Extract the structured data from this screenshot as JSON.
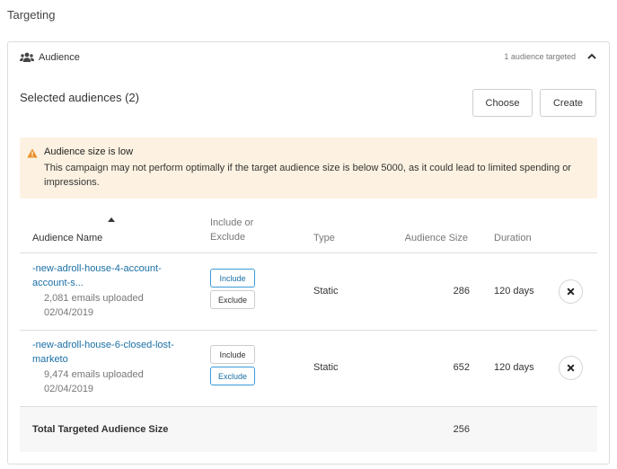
{
  "section_title": "Targeting",
  "panel": {
    "label": "Audience",
    "targeted_count": "1 audience targeted"
  },
  "selected_title": "Selected audiences (2)",
  "buttons": {
    "choose": "Choose",
    "create": "Create"
  },
  "warning": {
    "title": "Audience size is low",
    "text": "This campaign may not perform optimally if the target audience size is below 5000, as it could lead to limited spending or impressions."
  },
  "table": {
    "headers": {
      "name": "Audience Name",
      "include_exclude": "Include or Exclude",
      "type": "Type",
      "size": "Audience Size",
      "duration": "Duration"
    },
    "rows": [
      {
        "name": "-new-adroll-house-4-account-account-s...",
        "uploaded": "2,081 emails uploaded",
        "date": "02/04/2019",
        "include_label": "Include",
        "exclude_label": "Exclude",
        "selected": "include",
        "type": "Static",
        "size": "286",
        "duration": "120 days"
      },
      {
        "name": "-new-adroll-house-6-closed-lost-marketo",
        "uploaded": "9,474 emails uploaded",
        "date": "02/04/2019",
        "include_label": "Include",
        "exclude_label": "Exclude",
        "selected": "exclude",
        "type": "Static",
        "size": "652",
        "duration": "120 days"
      }
    ],
    "total_label": "Total Targeted Audience Size",
    "total_value": "256"
  },
  "colors": {
    "link": "#1a6fa5",
    "active_border": "#3b9ad9",
    "warning_bg": "#fdf2e1",
    "warning_icon": "#e8902a"
  }
}
